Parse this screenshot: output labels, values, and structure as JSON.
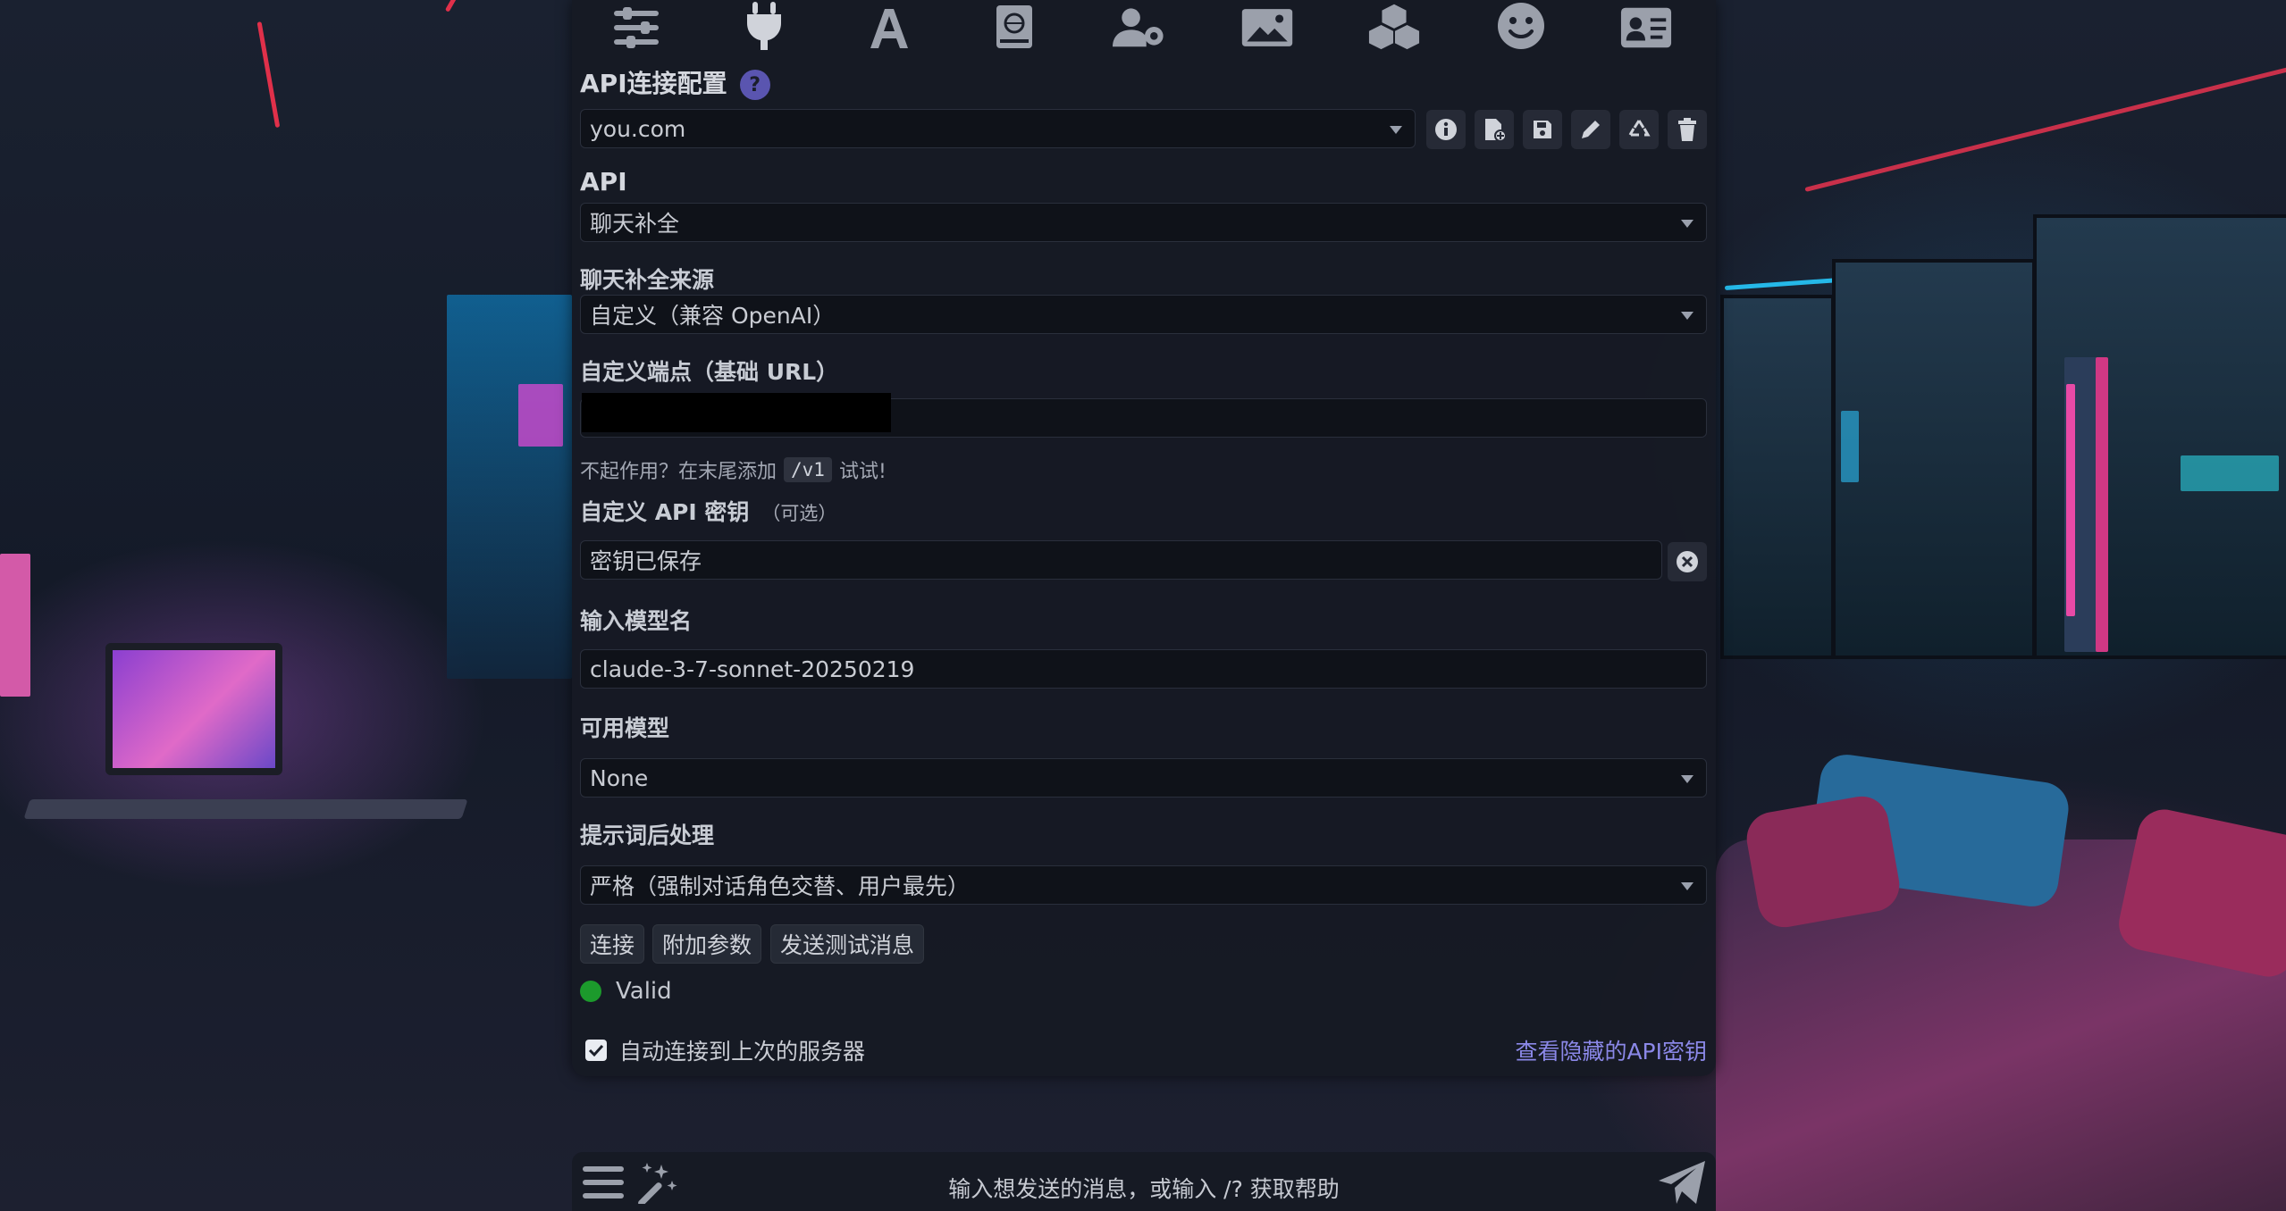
{
  "top_nav": {
    "icons": [
      "sliders-icon",
      "plug-icon",
      "font-icon",
      "book-globe-icon",
      "user-gear-icon",
      "image-icon",
      "cubes-icon",
      "smiley-icon",
      "id-card-icon"
    ]
  },
  "api_config": {
    "title": "API连接配置",
    "help": "?",
    "profile_value": "you.com",
    "toolbar_icons": [
      "info-icon",
      "file-add-icon",
      "save-icon",
      "pencil-icon",
      "recycle-icon",
      "trash-icon"
    ]
  },
  "api": {
    "label": "API",
    "value": "聊天补全"
  },
  "source": {
    "label": "聊天补全来源",
    "value": "自定义（兼容 OpenAI）"
  },
  "endpoint": {
    "label": "自定义端点（基础 URL）",
    "hint_prefix": "不起作用？在末尾添加",
    "hint_code": "/v1",
    "hint_suffix": "试试!"
  },
  "api_key": {
    "label": "自定义 API 密钥",
    "optional": "（可选）",
    "value": "密钥已保存"
  },
  "model_name": {
    "label": "输入模型名",
    "value": "claude-3-7-sonnet-20250219"
  },
  "available_models": {
    "label": "可用模型",
    "value": "None"
  },
  "prompt_post": {
    "label": "提示词后处理",
    "value": "严格（强制对话角色交替、用户最先）"
  },
  "buttons": {
    "connect": "连接",
    "extra_params": "附加参数",
    "send_test": "发送测试消息"
  },
  "status": {
    "text": "Valid",
    "color": "#1c9a2c"
  },
  "auto_connect": {
    "label": "自动连接到上次的服务器",
    "checked": true
  },
  "hidden_keys_link": "查看隐藏的API密钥",
  "composer": {
    "placeholder": "输入想发送的消息，或输入 /? 获取帮助"
  }
}
